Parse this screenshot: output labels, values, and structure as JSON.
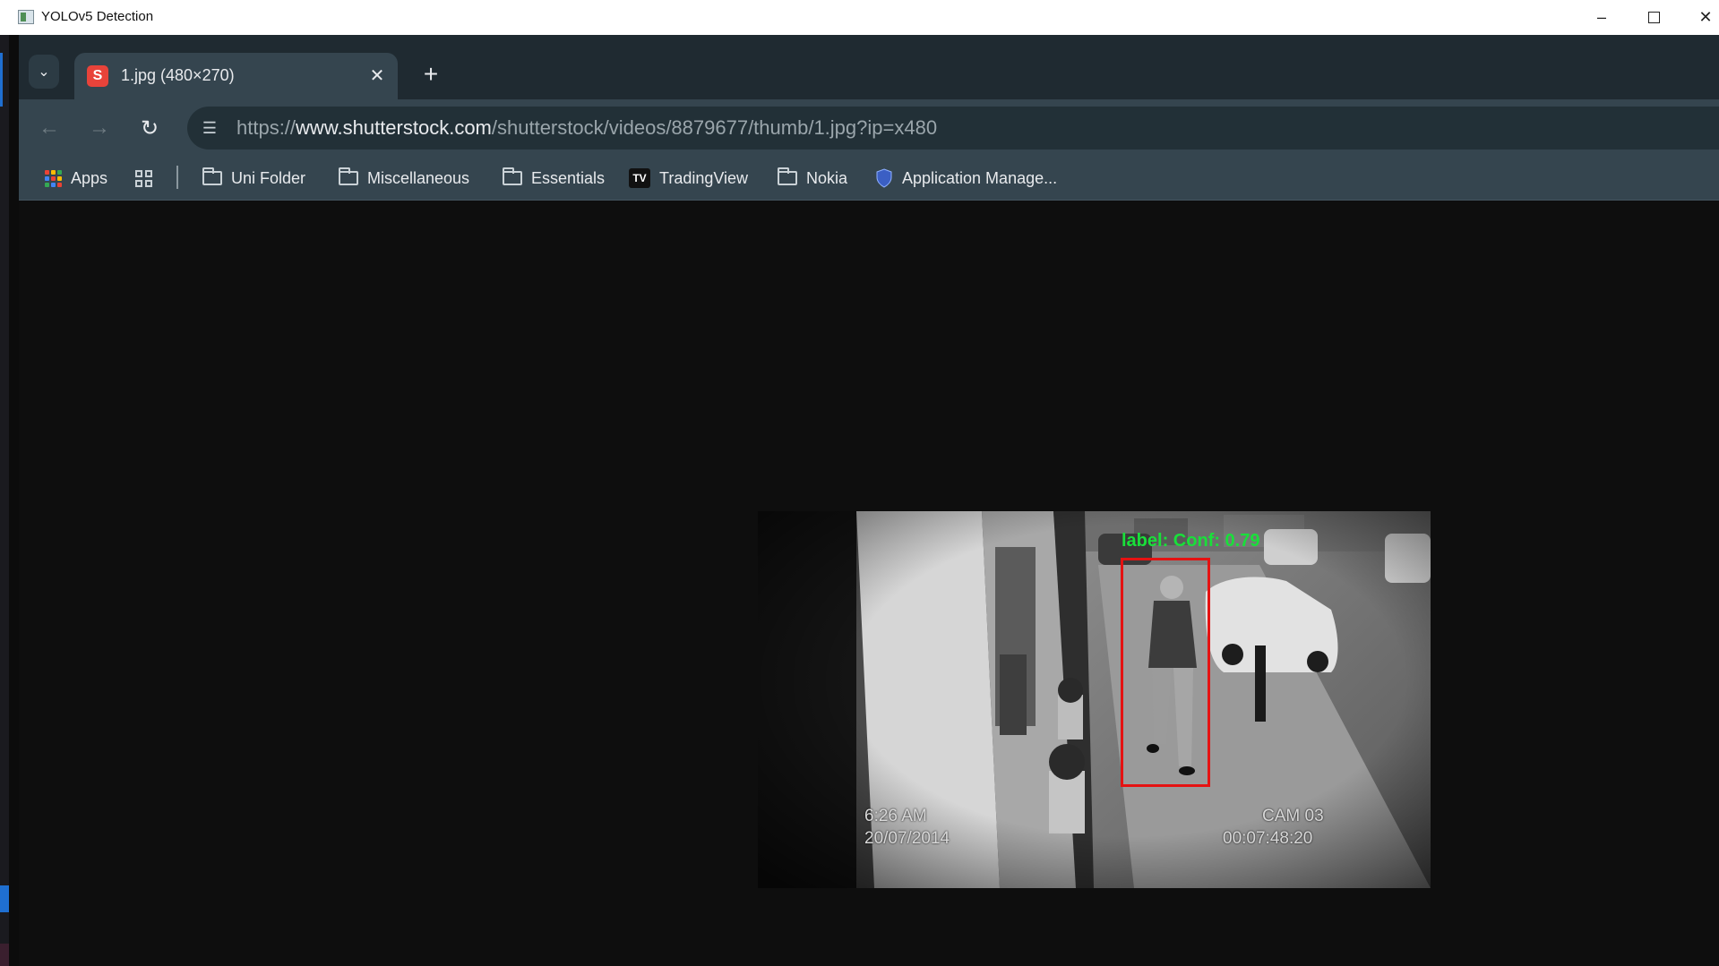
{
  "window": {
    "title": "YOLOv5 Detection",
    "minimize_icon": "minimize-icon",
    "maximize_icon": "maximize-icon",
    "close_icon": "close-icon"
  },
  "browser": {
    "tab": {
      "title": "1.jpg (480×270)",
      "favicon": "shutterstock-icon"
    },
    "url": {
      "scheme": "https://",
      "host": "www.shutterstock.com",
      "path": "/shutterstock/videos/8879677/thumb/1.jpg?ip=x480"
    },
    "bookmarks": [
      {
        "label": "Apps",
        "icon": "apps-grid-icon"
      },
      {
        "label": "",
        "icon": "tab-groups-icon"
      },
      {
        "label": "Uni Folder",
        "icon": "folder-icon"
      },
      {
        "label": "Miscellaneous",
        "icon": "folder-icon"
      },
      {
        "label": "Essentials",
        "icon": "folder-icon"
      },
      {
        "label": "TradingView",
        "icon": "tradingview-icon"
      },
      {
        "label": "Nokia",
        "icon": "folder-icon"
      },
      {
        "label": "Application Manage...",
        "icon": "shield-icon"
      }
    ]
  },
  "image": {
    "timestamp_time": "6:26 AM",
    "timestamp_date": "20/07/2014",
    "camera": "CAM 03",
    "timecode": "00:07:48:20",
    "detection_label": "label: Conf: 0.79",
    "detection_color": "#e51212",
    "label_color": "#19e03a"
  }
}
